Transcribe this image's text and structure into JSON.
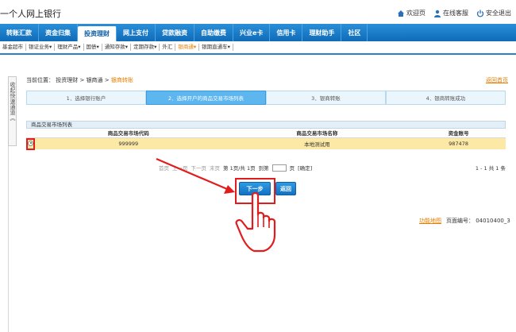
{
  "header": {
    "brand": "一个人网上银行",
    "tools": [
      {
        "icon": "home-icon",
        "label": "欢迎页"
      },
      {
        "icon": "user-icon",
        "label": "在线客服"
      },
      {
        "icon": "power-icon",
        "label": "安全退出"
      }
    ]
  },
  "nav": {
    "items": [
      {
        "label": "转账汇款",
        "active": false
      },
      {
        "label": "资金归集",
        "active": false
      },
      {
        "label": "投资理财",
        "active": true
      },
      {
        "label": "网上支付",
        "active": false
      },
      {
        "label": "贷款融资",
        "active": false
      },
      {
        "label": "自助缴费",
        "active": false
      },
      {
        "label": "兴业e卡",
        "active": false
      },
      {
        "label": "信用卡",
        "active": false
      },
      {
        "label": "理财助手",
        "active": false
      },
      {
        "label": "社区",
        "active": false
      }
    ]
  },
  "subnav": {
    "items": [
      {
        "label": "基金超市",
        "active": false
      },
      {
        "label": "银证业务▾",
        "active": false
      },
      {
        "label": "理财产品▾",
        "active": false
      },
      {
        "label": "国债▾",
        "active": false
      },
      {
        "label": "通知存款▾",
        "active": false
      },
      {
        "label": "定期存款▾",
        "active": false
      },
      {
        "label": "外汇",
        "active": false
      },
      {
        "label": "银商通▾",
        "active": true
      },
      {
        "label": "银期直通车▾",
        "active": false
      }
    ]
  },
  "sidebar": {
    "label": "收起快速通道《"
  },
  "breadcrumb": {
    "prefix": "当前位置：",
    "path1": "投资理财",
    "sep": " > ",
    "path2": "银商通",
    "current": "银商转账"
  },
  "return_link": "返回首页",
  "steps": [
    {
      "label": "1．选择银行账户",
      "active": false
    },
    {
      "label": "2．选择开户的商品交易市场列表",
      "active": true
    },
    {
      "label": "3．银商转账",
      "active": false
    },
    {
      "label": "4．银商转账成功",
      "active": false
    }
  ],
  "panel": {
    "title": "商品交易市场列表",
    "columns": [
      "商品交易市场代码",
      "商品交易市场名称",
      "资金账号"
    ],
    "rows": [
      {
        "code": "999999",
        "name": "本地测试用",
        "account": "987478"
      }
    ]
  },
  "pager": {
    "first": "首页",
    "prev": "上一页",
    "next": "下一页",
    "last": "末页",
    "info": "第 1页/共 1页",
    "goto": "到第",
    "page_unit": "页",
    "confirm": "[确定]",
    "range": "1 - 1  共 1 条"
  },
  "buttons": {
    "next": "下一步",
    "back": "返回"
  },
  "footer": {
    "link": "功能地图",
    "page_no": "页面编号：  04010400_3"
  },
  "colors": {
    "accent": "#1271c2",
    "highlight": "#fde9a6",
    "annotation": "#e21c1c",
    "link": "#e57d00"
  }
}
